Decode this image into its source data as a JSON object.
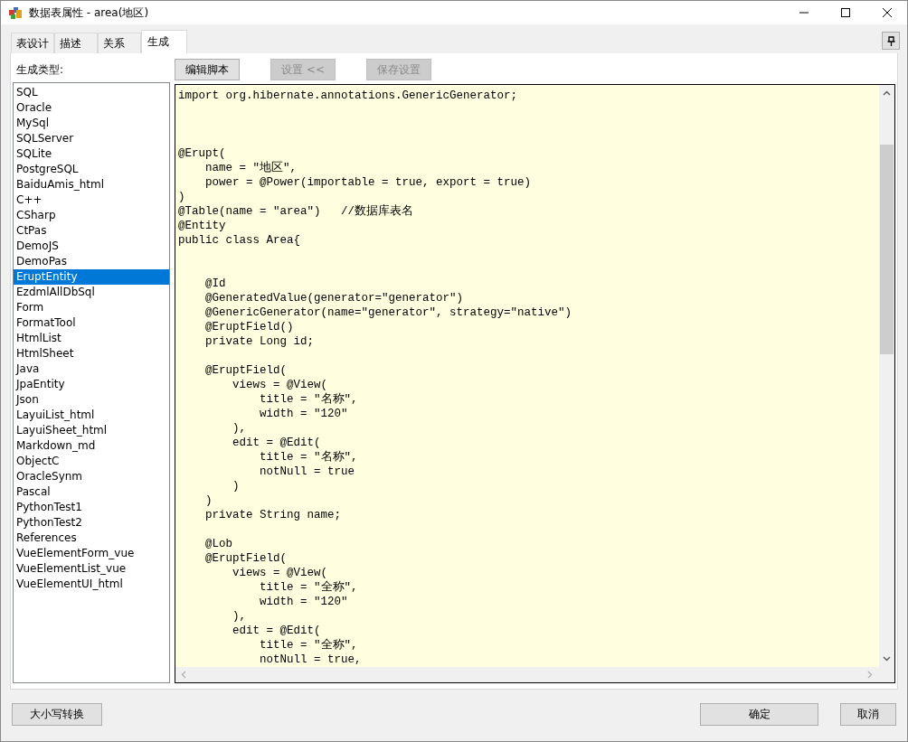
{
  "window": {
    "title": "数据表属性 - area(地区)"
  },
  "tabs": [
    {
      "label": "表设计",
      "selected": false
    },
    {
      "label": "描述",
      "selected": false
    },
    {
      "label": "关系",
      "selected": false
    },
    {
      "label": "生成",
      "selected": true
    }
  ],
  "generate_types": {
    "label": "生成类型:",
    "items": [
      {
        "label": "SQL",
        "selected": false
      },
      {
        "label": "Oracle",
        "selected": false
      },
      {
        "label": "MySql",
        "selected": false
      },
      {
        "label": "SQLServer",
        "selected": false
      },
      {
        "label": "SQLite",
        "selected": false
      },
      {
        "label": "PostgreSQL",
        "selected": false
      },
      {
        "label": "BaiduAmis_html",
        "selected": false
      },
      {
        "label": "C++",
        "selected": false
      },
      {
        "label": "CSharp",
        "selected": false
      },
      {
        "label": "CtPas",
        "selected": false
      },
      {
        "label": "DemoJS",
        "selected": false
      },
      {
        "label": "DemoPas",
        "selected": false
      },
      {
        "label": "EruptEntity",
        "selected": true
      },
      {
        "label": "EzdmlAllDbSql",
        "selected": false
      },
      {
        "label": "Form",
        "selected": false
      },
      {
        "label": "FormatTool",
        "selected": false
      },
      {
        "label": "HtmlList",
        "selected": false
      },
      {
        "label": "HtmlSheet",
        "selected": false
      },
      {
        "label": "Java",
        "selected": false
      },
      {
        "label": "JpaEntity",
        "selected": false
      },
      {
        "label": "Json",
        "selected": false
      },
      {
        "label": "LayuiList_html",
        "selected": false
      },
      {
        "label": "LayuiSheet_html",
        "selected": false
      },
      {
        "label": "Markdown_md",
        "selected": false
      },
      {
        "label": "ObjectC",
        "selected": false
      },
      {
        "label": "OracleSynm",
        "selected": false
      },
      {
        "label": "Pascal",
        "selected": false
      },
      {
        "label": "PythonTest1",
        "selected": false
      },
      {
        "label": "PythonTest2",
        "selected": false
      },
      {
        "label": "References",
        "selected": false
      },
      {
        "label": "VueElementForm_vue",
        "selected": false
      },
      {
        "label": "VueElementList_vue",
        "selected": false
      },
      {
        "label": "VueElementUI_html",
        "selected": false
      }
    ]
  },
  "toolbar": [
    {
      "label": "编辑脚本",
      "disabled": false
    },
    {
      "label": "设置 <<",
      "disabled": true
    },
    {
      "label": "保存设置",
      "disabled": true
    }
  ],
  "code": "import org.hibernate.annotations.GenericGenerator;\n\n\n\n@Erupt(\n    name = \"地区\",\n    power = @Power(importable = true, export = true)\n)\n@Table(name = \"area\")   //数据库表名\n@Entity\npublic class Area{\n\n\n    @Id\n    @GeneratedValue(generator=\"generator\")\n    @GenericGenerator(name=\"generator\", strategy=\"native\")\n    @EruptField()\n    private Long id;\n\n    @EruptField(\n        views = @View(\n            title = \"名称\",\n            width = \"120\"\n        ),\n        edit = @Edit(\n            title = \"名称\",\n            notNull = true\n        )\n    )\n    private String name;\n\n    @Lob\n    @EruptField(\n        views = @View(\n            title = \"全称\",\n            width = \"120\"\n        ),\n        edit = @Edit(\n            title = \"全称\",\n            notNull = true,",
  "footer": {
    "left_button": "大小写转换",
    "ok_button": "确定",
    "cancel_button": "取消"
  }
}
